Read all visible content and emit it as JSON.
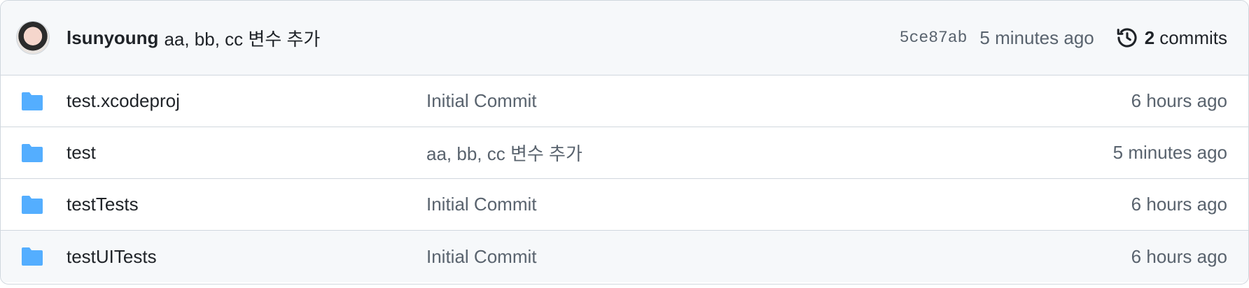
{
  "latest_commit": {
    "author": "lsunyoung",
    "message": "aa, bb, cc 변수 추가",
    "sha": "5ce87ab",
    "time": "5 minutes ago",
    "commit_count": "2",
    "commits_label": "commits"
  },
  "files": [
    {
      "name": "test.xcodeproj",
      "message": "Initial Commit",
      "time": "6 hours ago",
      "type": "folder"
    },
    {
      "name": "test",
      "message": "aa, bb, cc 변수 추가",
      "time": "5 minutes ago",
      "type": "folder"
    },
    {
      "name": "testTests",
      "message": "Initial Commit",
      "time": "6 hours ago",
      "type": "folder"
    },
    {
      "name": "testUITests",
      "message": "Initial Commit",
      "time": "6 hours ago",
      "type": "folder"
    }
  ],
  "colors": {
    "folder": "#54aeff",
    "muted_text": "#59636e",
    "border": "#d0d7de",
    "header_bg": "#f6f8fa"
  },
  "icons": [
    "avatar",
    "history-icon",
    "folder-icon"
  ]
}
